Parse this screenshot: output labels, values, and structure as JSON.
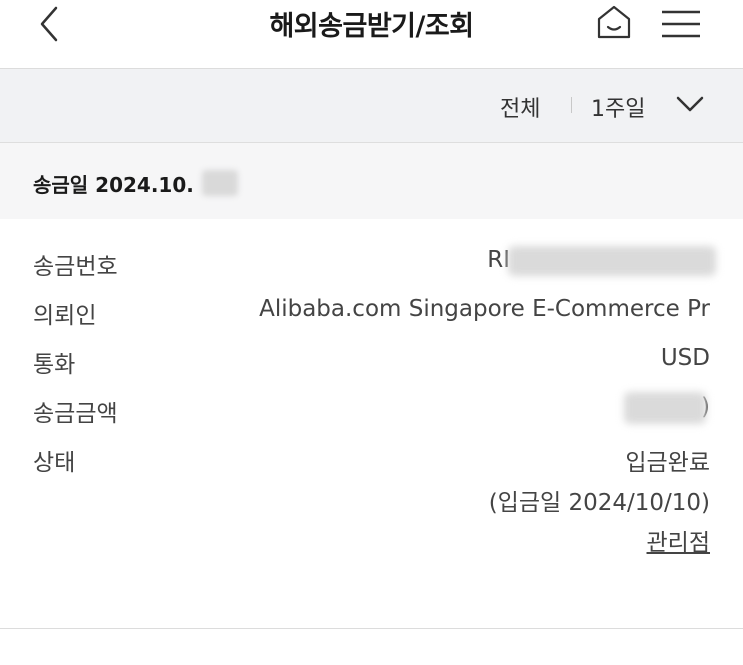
{
  "header": {
    "title": "해외송금받기/조회"
  },
  "filter": {
    "type_label": "전체",
    "period_label": "1주일"
  },
  "remittance": {
    "date_label": "송금일 2024.10.",
    "rows": [
      {
        "label": "송금번호",
        "value": "RI"
      },
      {
        "label": "의뢰인",
        "value": "Alibaba.com Singapore E-Commerce Pr"
      },
      {
        "label": "통화",
        "value": "USD"
      },
      {
        "label": "송금금액",
        "value": ")"
      },
      {
        "label": "상태",
        "value": "입금완료"
      }
    ],
    "deposit_date": "(입금일 2024/10/10)",
    "branch_link": "관리점"
  },
  "icons": {
    "back": "chevron-left-icon",
    "home": "home-icon",
    "menu": "hamburger-menu-icon",
    "dropdown": "chevron-down-icon"
  }
}
